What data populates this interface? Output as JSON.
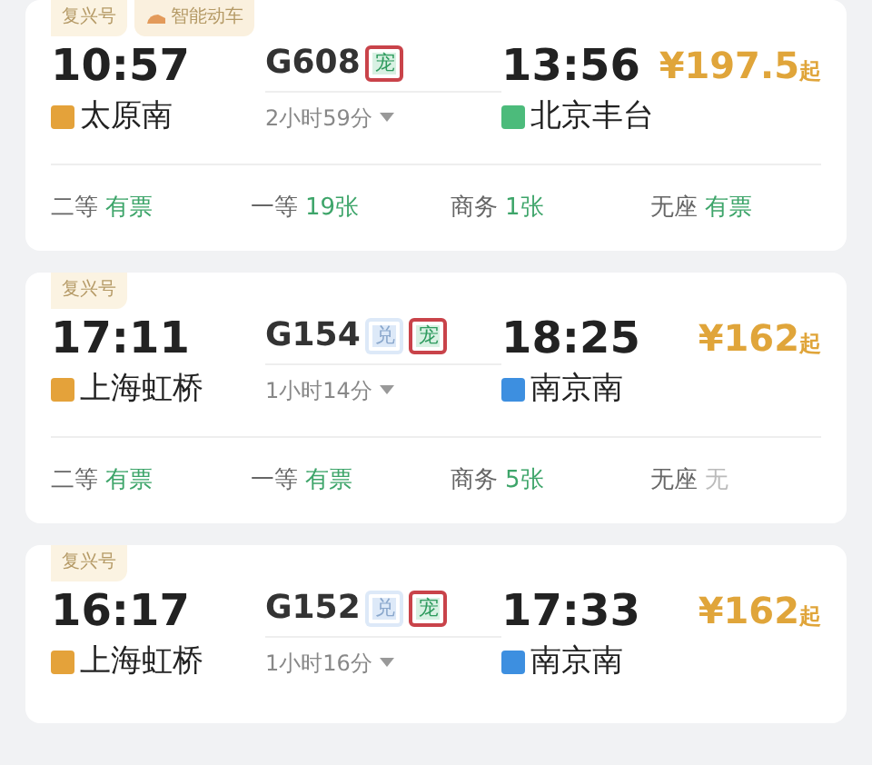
{
  "trains": [
    {
      "labels": [
        {
          "text": "复兴号",
          "kind": "series"
        },
        {
          "text": "智能动车",
          "kind": "smart"
        }
      ],
      "depart_time": "10:57",
      "number": "G608",
      "tags": [
        {
          "text": "宠",
          "kind": "pet",
          "highlighted": true
        }
      ],
      "arrive_time": "13:56",
      "from": {
        "name": "太原南",
        "kind": "origin"
      },
      "duration": "2小时59分",
      "to": {
        "name": "北京丰台",
        "kind": "terminal"
      },
      "price": "¥197.5",
      "price_suffix": "起",
      "seats": [
        {
          "class": "二等",
          "status": "有票",
          "available": true
        },
        {
          "class": "一等",
          "status": "19张",
          "available": true
        },
        {
          "class": "商务",
          "status": "1张",
          "available": true
        },
        {
          "class": "无座",
          "status": "有票",
          "available": true
        }
      ]
    },
    {
      "labels": [
        {
          "text": "复兴号",
          "kind": "series"
        }
      ],
      "depart_time": "17:11",
      "number": "G154",
      "tags": [
        {
          "text": "兑",
          "kind": "exchange",
          "highlighted": false
        },
        {
          "text": "宠",
          "kind": "pet",
          "highlighted": true
        }
      ],
      "arrive_time": "18:25",
      "from": {
        "name": "上海虹桥",
        "kind": "origin"
      },
      "duration": "1小时14分",
      "to": {
        "name": "南京南",
        "kind": "pass"
      },
      "price": "¥162",
      "price_suffix": "起",
      "seats": [
        {
          "class": "二等",
          "status": "有票",
          "available": true
        },
        {
          "class": "一等",
          "status": "有票",
          "available": true
        },
        {
          "class": "商务",
          "status": "5张",
          "available": true
        },
        {
          "class": "无座",
          "status": "无",
          "available": false
        }
      ]
    },
    {
      "labels": [
        {
          "text": "复兴号",
          "kind": "series"
        }
      ],
      "depart_time": "16:17",
      "number": "G152",
      "tags": [
        {
          "text": "兑",
          "kind": "exchange",
          "highlighted": false
        },
        {
          "text": "宠",
          "kind": "pet",
          "highlighted": true
        }
      ],
      "arrive_time": "17:33",
      "from": {
        "name": "上海虹桥",
        "kind": "origin"
      },
      "duration": "1小时16分",
      "to": {
        "name": "南京南",
        "kind": "pass"
      },
      "price": "¥162",
      "price_suffix": "起"
    }
  ]
}
